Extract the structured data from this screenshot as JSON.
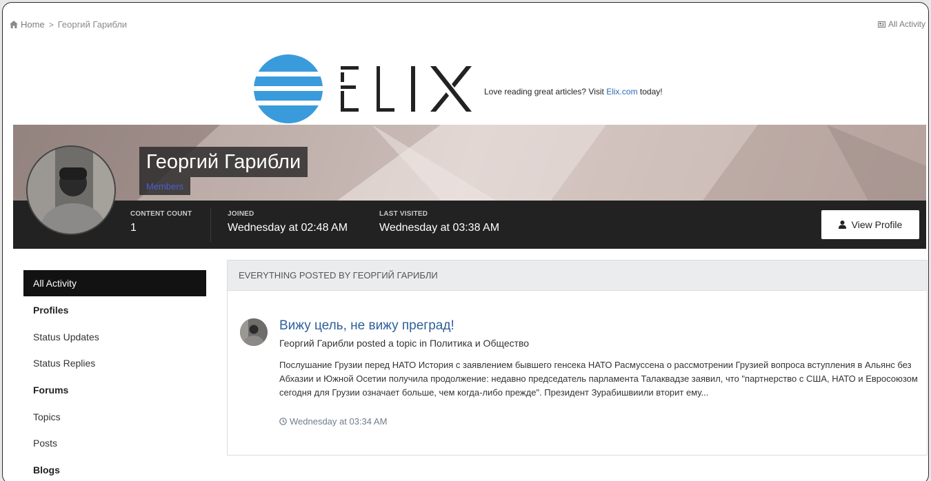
{
  "breadcrumb": {
    "home_label": "Home",
    "separator": ">",
    "current": "Георгий Гарибли"
  },
  "top_links": {
    "all_activity": "All Activity"
  },
  "banner": {
    "brand": "ELIX",
    "tagline_before": "Love reading great articles? Visit ",
    "link_text": "Elix.com",
    "tagline_after": " today!",
    "colors": {
      "logo_blue": "#3a9bdc",
      "logo_text": "#222222"
    }
  },
  "profile": {
    "name": "Георгий Гарибли",
    "group": "Members",
    "stats": [
      {
        "label": "CONTENT COUNT",
        "value": "1"
      },
      {
        "label": "JOINED",
        "value": "Wednesday at 02:48 AM"
      },
      {
        "label": "LAST VISITED",
        "value": "Wednesday at 03:38 AM"
      }
    ],
    "view_profile_label": "View Profile"
  },
  "sidebar": {
    "items": [
      {
        "type": "item",
        "label": "All Activity",
        "active": true
      },
      {
        "type": "heading",
        "label": "Profiles"
      },
      {
        "type": "item",
        "label": "Status Updates"
      },
      {
        "type": "item",
        "label": "Status Replies"
      },
      {
        "type": "heading",
        "label": "Forums"
      },
      {
        "type": "item",
        "label": "Topics"
      },
      {
        "type": "item",
        "label": "Posts"
      },
      {
        "type": "heading",
        "label": "Blogs"
      }
    ]
  },
  "main": {
    "panel_title": "EVERYTHING POSTED BY ГЕОРГИЙ ГАРИБЛИ",
    "post": {
      "title": "Вижу цель, не вижу преград!",
      "author": "Георгий Гарибли",
      "action": " posted a topic in ",
      "forum": "Политика и Общество",
      "excerpt": "Послушание Грузии перед НАТО История с заявлением бывшего генсека НАТО Расмуссена о рассмотрении Грузией вопроса вступления в Альянс без Абхазии и Южной Осетии получила продолжение: недавно председатель парламента Талаквадзе заявил, что \"партнерство с США, НАТО и Евросоюзом сегодня для Грузии означает больше, чем когда-либо прежде\". Президент Зурабишвиили вторит ему...",
      "time": "Wednesday at 03:34 AM"
    }
  },
  "icons": {
    "home": "home-icon",
    "activity": "activity-icon",
    "user": "user-icon",
    "clock": "clock-icon"
  },
  "colors": {
    "accent_link": "#2e5f9c",
    "stat_bar": "#222222",
    "group_color": "#4a5fd6",
    "active_sidebar": "#121212"
  }
}
